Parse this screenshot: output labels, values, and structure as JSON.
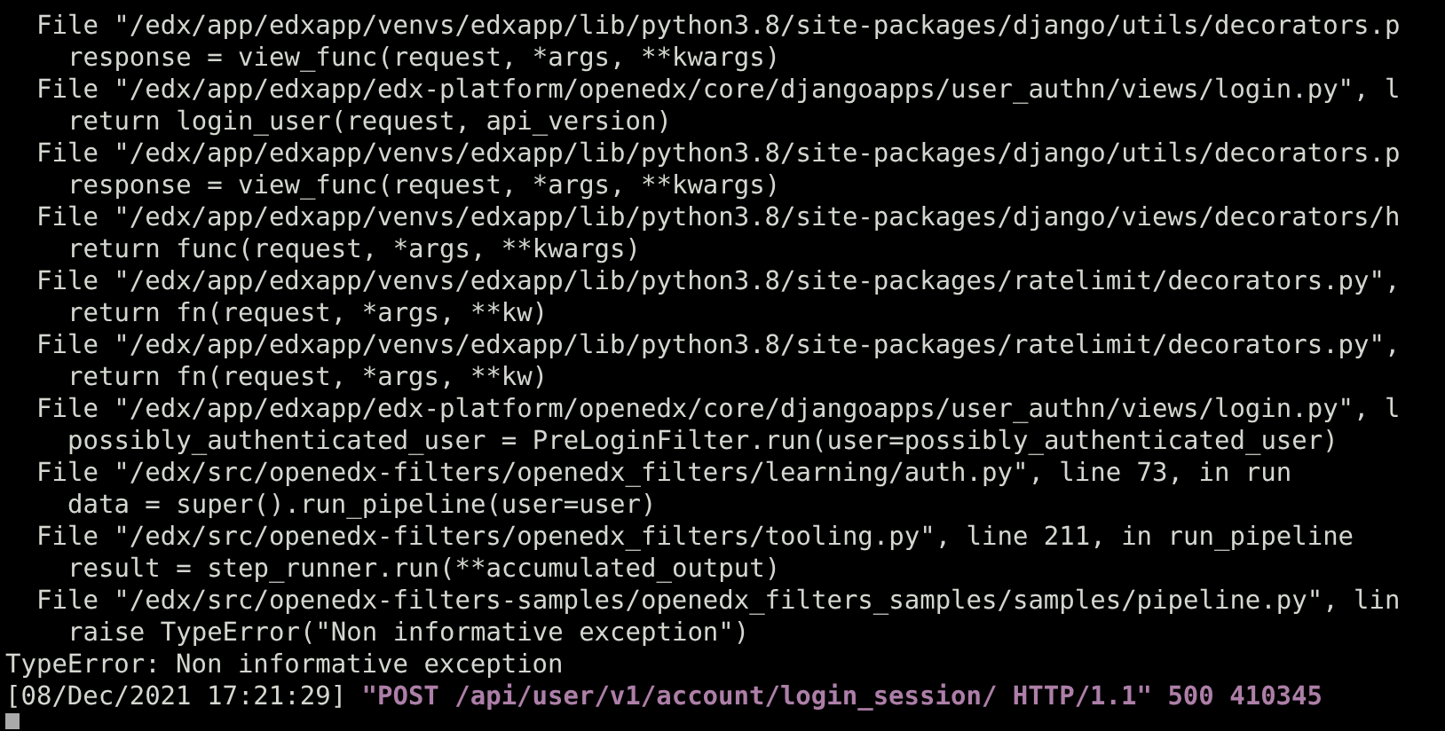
{
  "terminal": {
    "lines": [
      {
        "kind": "frame",
        "text": "File \"/edx/app/edxapp/venvs/edxapp/lib/python3.8/site-packages/django/utils/decorators.p"
      },
      {
        "kind": "code",
        "text": "response = view_func(request, *args, **kwargs)"
      },
      {
        "kind": "frame",
        "text": "File \"/edx/app/edxapp/edx-platform/openedx/core/djangoapps/user_authn/views/login.py\", l"
      },
      {
        "kind": "code",
        "text": "return login_user(request, api_version)"
      },
      {
        "kind": "frame",
        "text": "File \"/edx/app/edxapp/venvs/edxapp/lib/python3.8/site-packages/django/utils/decorators.p"
      },
      {
        "kind": "code",
        "text": "response = view_func(request, *args, **kwargs)"
      },
      {
        "kind": "frame",
        "text": "File \"/edx/app/edxapp/venvs/edxapp/lib/python3.8/site-packages/django/views/decorators/h"
      },
      {
        "kind": "code",
        "text": "return func(request, *args, **kwargs)"
      },
      {
        "kind": "frame",
        "text": "File \"/edx/app/edxapp/venvs/edxapp/lib/python3.8/site-packages/ratelimit/decorators.py\","
      },
      {
        "kind": "code",
        "text": "return fn(request, *args, **kw)"
      },
      {
        "kind": "frame",
        "text": "File \"/edx/app/edxapp/venvs/edxapp/lib/python3.8/site-packages/ratelimit/decorators.py\","
      },
      {
        "kind": "code",
        "text": "return fn(request, *args, **kw)"
      },
      {
        "kind": "frame",
        "text": "File \"/edx/app/edxapp/edx-platform/openedx/core/djangoapps/user_authn/views/login.py\", l"
      },
      {
        "kind": "code",
        "text": "possibly_authenticated_user = PreLoginFilter.run(user=possibly_authenticated_user)"
      },
      {
        "kind": "frame",
        "text": "File \"/edx/src/openedx-filters/openedx_filters/learning/auth.py\", line 73, in run"
      },
      {
        "kind": "code",
        "text": "data = super().run_pipeline(user=user)"
      },
      {
        "kind": "frame",
        "text": "File \"/edx/src/openedx-filters/openedx_filters/tooling.py\", line 211, in run_pipeline"
      },
      {
        "kind": "code",
        "text": "result = step_runner.run(**accumulated_output)"
      },
      {
        "kind": "frame",
        "text": "File \"/edx/src/openedx-filters-samples/openedx_filters_samples/samples/pipeline.py\", lin"
      },
      {
        "kind": "code",
        "text": "raise TypeError(\"Non informative exception\")"
      },
      {
        "kind": "error",
        "text": "TypeError: Non informative exception"
      }
    ],
    "log_line": {
      "timestamp": "[08/Dec/2021 17:21:29]",
      "request": "\"POST /api/user/v1/account/login_session/ HTTP/1.1\" 500 410345"
    }
  }
}
